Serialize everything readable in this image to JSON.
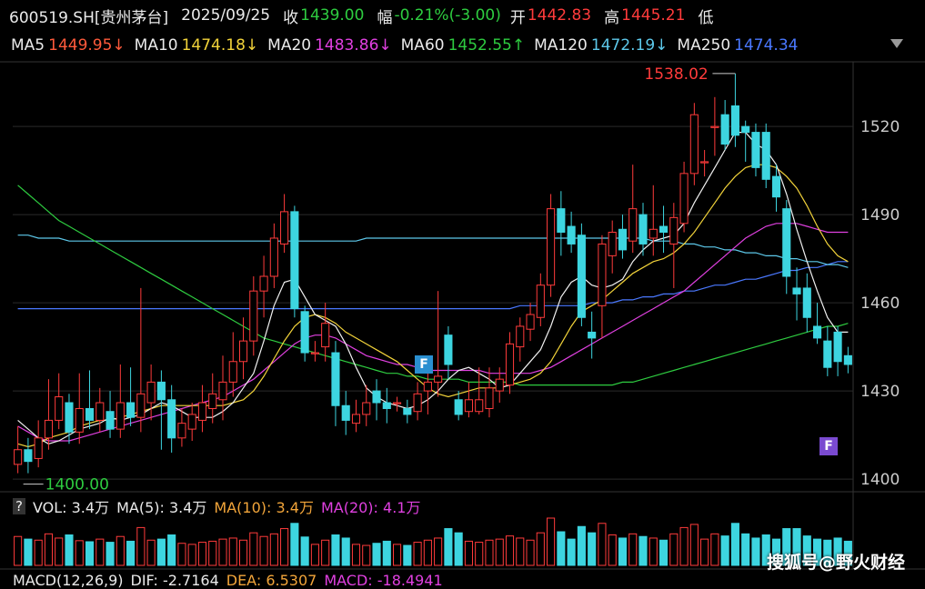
{
  "header": {
    "symbol": "600519.SH[贵州茅台]",
    "date": "2025/09/25",
    "close_label": "收",
    "close": "1439.00",
    "change_label": "幅",
    "change": "-0.21%(-3.00)",
    "open_label": "开",
    "open": "1442.83",
    "high_label": "高",
    "high": "1445.21",
    "low_label": "低"
  },
  "ma_bar": {
    "ma5_label": "MA5",
    "ma5": "1449.95↓",
    "ma10_label": "MA10",
    "ma10": "1474.18↓",
    "ma20_label": "MA20",
    "ma20": "1483.86↓",
    "ma60_label": "MA60",
    "ma60": "1452.55↑",
    "ma120_label": "MA120",
    "ma120": "1472.19↓",
    "ma250_label": "MA250",
    "ma250": "1474.34"
  },
  "volume_bar": {
    "question": "?",
    "vol": "VOL: 3.4万",
    "ma5": "MA(5): 3.4万",
    "ma10": "MA(10): 3.4万",
    "ma20": "MA(20): 4.1万"
  },
  "macd_bar": {
    "label": "MACD(12,26,9)",
    "dif": "DIF: -2.7164",
    "dea": "DEA: 6.5307",
    "macd": "MACD: -18.4941"
  },
  "annotations": {
    "high_marker": "1538.02",
    "low_marker": "1400.00",
    "flag1": "F",
    "flag2": "F"
  },
  "watermark": "搜狐号@野火财经",
  "colors": {
    "up": "#ff3b3b",
    "down": "#3dd5e0",
    "ma5": "#f0f0f0",
    "ma10": "#f2d33a",
    "ma20": "#e040e0",
    "ma60": "#2ecc40",
    "ma120": "#5dc8ea",
    "ma250": "#4a78ff",
    "grid": "#2a2a2a",
    "change": "#2ecc40",
    "price_up": "#ff3b3b"
  },
  "chart_data": {
    "type": "candlestick",
    "yaxis_ticks": [
      1400,
      1430,
      1460,
      1490,
      1520
    ],
    "ylim": [
      1396,
      1542
    ],
    "candles": [
      {
        "o": 1405,
        "c": 1410,
        "h": 1418,
        "l": 1402
      },
      {
        "o": 1410,
        "c": 1406,
        "h": 1414,
        "l": 1402
      },
      {
        "o": 1407,
        "c": 1414,
        "h": 1420,
        "l": 1404
      },
      {
        "o": 1414,
        "c": 1420,
        "h": 1434,
        "l": 1410
      },
      {
        "o": 1420,
        "c": 1428,
        "h": 1436,
        "l": 1417
      },
      {
        "o": 1426,
        "c": 1416,
        "h": 1429,
        "l": 1412
      },
      {
        "o": 1416,
        "c": 1424,
        "h": 1436,
        "l": 1412
      },
      {
        "o": 1424,
        "c": 1420,
        "h": 1437,
        "l": 1417
      },
      {
        "o": 1420,
        "c": 1426,
        "h": 1431,
        "l": 1416
      },
      {
        "o": 1423,
        "c": 1417,
        "h": 1430,
        "l": 1414
      },
      {
        "o": 1417,
        "c": 1426,
        "h": 1439,
        "l": 1414
      },
      {
        "o": 1426,
        "c": 1421,
        "h": 1438,
        "l": 1418
      },
      {
        "o": 1421,
        "c": 1429,
        "h": 1465,
        "l": 1416
      },
      {
        "o": 1426,
        "c": 1433,
        "h": 1439,
        "l": 1420
      },
      {
        "o": 1433,
        "c": 1427,
        "h": 1437,
        "l": 1410
      },
      {
        "o": 1427,
        "c": 1414,
        "h": 1432,
        "l": 1409
      },
      {
        "o": 1414,
        "c": 1419,
        "h": 1424,
        "l": 1411
      },
      {
        "o": 1417,
        "c": 1422,
        "h": 1426,
        "l": 1413
      },
      {
        "o": 1420,
        "c": 1426,
        "h": 1432,
        "l": 1416
      },
      {
        "o": 1424,
        "c": 1429,
        "h": 1436,
        "l": 1419
      },
      {
        "o": 1427,
        "c": 1433,
        "h": 1442,
        "l": 1420
      },
      {
        "o": 1433,
        "c": 1440,
        "h": 1450,
        "l": 1428
      },
      {
        "o": 1440,
        "c": 1447,
        "h": 1455,
        "l": 1434
      },
      {
        "o": 1447,
        "c": 1464,
        "h": 1469,
        "l": 1442
      },
      {
        "o": 1464,
        "c": 1469,
        "h": 1476,
        "l": 1455
      },
      {
        "o": 1469,
        "c": 1482,
        "h": 1487,
        "l": 1465
      },
      {
        "o": 1480,
        "c": 1491,
        "h": 1497,
        "l": 1477
      },
      {
        "o": 1491,
        "c": 1458,
        "h": 1493,
        "l": 1455
      },
      {
        "o": 1457,
        "c": 1443,
        "h": 1459,
        "l": 1440
      },
      {
        "o": 1443,
        "c": 1443,
        "h": 1447,
        "l": 1440
      },
      {
        "o": 1445,
        "c": 1453,
        "h": 1460,
        "l": 1440
      },
      {
        "o": 1443,
        "c": 1425,
        "h": 1447,
        "l": 1418
      },
      {
        "o": 1425,
        "c": 1420,
        "h": 1430,
        "l": 1415
      },
      {
        "o": 1419,
        "c": 1422,
        "h": 1427,
        "l": 1416
      },
      {
        "o": 1422,
        "c": 1426,
        "h": 1432,
        "l": 1418
      },
      {
        "o": 1430,
        "c": 1426,
        "h": 1434,
        "l": 1420
      },
      {
        "o": 1426,
        "c": 1424,
        "h": 1431,
        "l": 1419
      },
      {
        "o": 1426,
        "c": 1426,
        "h": 1428,
        "l": 1423
      },
      {
        "o": 1424,
        "c": 1422,
        "h": 1427,
        "l": 1419
      },
      {
        "o": 1423,
        "c": 1429,
        "h": 1433,
        "l": 1420
      },
      {
        "o": 1430,
        "c": 1433,
        "h": 1439,
        "l": 1422
      },
      {
        "o": 1433,
        "c": 1435,
        "h": 1464,
        "l": 1428
      },
      {
        "o": 1449,
        "c": 1439,
        "h": 1452,
        "l": 1434
      },
      {
        "o": 1427,
        "c": 1422,
        "h": 1430,
        "l": 1420
      },
      {
        "o": 1423,
        "c": 1427,
        "h": 1433,
        "l": 1421
      },
      {
        "o": 1423,
        "c": 1427,
        "h": 1438,
        "l": 1422
      },
      {
        "o": 1424,
        "c": 1431,
        "h": 1438,
        "l": 1421
      },
      {
        "o": 1430,
        "c": 1434,
        "h": 1438,
        "l": 1426
      },
      {
        "o": 1432,
        "c": 1446,
        "h": 1450,
        "l": 1429
      },
      {
        "o": 1445,
        "c": 1452,
        "h": 1455,
        "l": 1440
      },
      {
        "o": 1451,
        "c": 1456,
        "h": 1460,
        "l": 1447
      },
      {
        "o": 1455,
        "c": 1466,
        "h": 1470,
        "l": 1452
      },
      {
        "o": 1466,
        "c": 1492,
        "h": 1497,
        "l": 1462
      },
      {
        "o": 1492,
        "c": 1484,
        "h": 1498,
        "l": 1476
      },
      {
        "o": 1486,
        "c": 1480,
        "h": 1491,
        "l": 1477
      },
      {
        "o": 1483,
        "c": 1455,
        "h": 1487,
        "l": 1452
      },
      {
        "o": 1450,
        "c": 1448,
        "h": 1457,
        "l": 1441
      },
      {
        "o": 1459,
        "c": 1480,
        "h": 1483,
        "l": 1448
      },
      {
        "o": 1476,
        "c": 1484,
        "h": 1488,
        "l": 1470
      },
      {
        "o": 1485,
        "c": 1478,
        "h": 1490,
        "l": 1475
      },
      {
        "o": 1481,
        "c": 1492,
        "h": 1507,
        "l": 1477
      },
      {
        "o": 1490,
        "c": 1480,
        "h": 1494,
        "l": 1476
      },
      {
        "o": 1482,
        "c": 1485,
        "h": 1500,
        "l": 1476
      },
      {
        "o": 1486,
        "c": 1484,
        "h": 1493,
        "l": 1477
      },
      {
        "o": 1480,
        "c": 1489,
        "h": 1494,
        "l": 1465
      },
      {
        "o": 1487,
        "c": 1504,
        "h": 1508,
        "l": 1484
      },
      {
        "o": 1504,
        "c": 1524,
        "h": 1528,
        "l": 1500
      },
      {
        "o": 1508,
        "c": 1508,
        "h": 1512,
        "l": 1503
      },
      {
        "o": 1520,
        "c": 1520,
        "h": 1530,
        "l": 1510
      },
      {
        "o": 1524,
        "c": 1514,
        "h": 1529,
        "l": 1512
      },
      {
        "o": 1527,
        "c": 1517,
        "h": 1538,
        "l": 1513
      },
      {
        "o": 1520,
        "c": 1518,
        "h": 1522,
        "l": 1508
      },
      {
        "o": 1518,
        "c": 1506,
        "h": 1521,
        "l": 1503
      },
      {
        "o": 1518,
        "c": 1502,
        "h": 1521,
        "l": 1499
      },
      {
        "o": 1503,
        "c": 1496,
        "h": 1507,
        "l": 1491
      },
      {
        "o": 1492,
        "c": 1469,
        "h": 1495,
        "l": 1463
      },
      {
        "o": 1465,
        "c": 1463,
        "h": 1472,
        "l": 1454
      },
      {
        "o": 1465,
        "c": 1455,
        "h": 1470,
        "l": 1450
      },
      {
        "o": 1452,
        "c": 1448,
        "h": 1460,
        "l": 1446
      },
      {
        "o": 1447,
        "c": 1438,
        "h": 1452,
        "l": 1435
      },
      {
        "o": 1450,
        "c": 1440,
        "h": 1452,
        "l": 1435
      },
      {
        "o": 1442,
        "c": 1439,
        "h": 1445,
        "l": 1436
      }
    ],
    "ma5": [
      1420,
      1417,
      1414,
      1412,
      1413,
      1415,
      1417,
      1418,
      1419,
      1421,
      1420,
      1421,
      1422,
      1424,
      1426,
      1425,
      1423,
      1421,
      1421,
      1421,
      1423,
      1426,
      1431,
      1436,
      1447,
      1459,
      1467,
      1468,
      1462,
      1456,
      1454,
      1452,
      1446,
      1438,
      1431,
      1428,
      1426,
      1425,
      1424,
      1425,
      1427,
      1430,
      1434,
      1437,
      1438,
      1436,
      1434,
      1431,
      1432,
      1436,
      1440,
      1444,
      1452,
      1462,
      1467,
      1469,
      1466,
      1465,
      1466,
      1468,
      1474,
      1478,
      1481,
      1482,
      1483,
      1487,
      1494,
      1500,
      1506,
      1512,
      1518,
      1518,
      1514,
      1512,
      1507,
      1497,
      1485,
      1474,
      1464,
      1455,
      1450,
      1450
    ],
    "ma10": [
      1412,
      1411,
      1412,
      1414,
      1415,
      1416,
      1418,
      1419,
      1420,
      1420,
      1421,
      1422,
      1423,
      1424,
      1425,
      1425,
      1425,
      1425,
      1425,
      1425,
      1425,
      1426,
      1427,
      1430,
      1435,
      1441,
      1447,
      1452,
      1455,
      1456,
      1455,
      1453,
      1450,
      1448,
      1446,
      1444,
      1442,
      1440,
      1437,
      1434,
      1431,
      1429,
      1428,
      1429,
      1430,
      1431,
      1431,
      1431,
      1432,
      1433,
      1434,
      1436,
      1440,
      1446,
      1452,
      1457,
      1459,
      1461,
      1464,
      1467,
      1470,
      1472,
      1474,
      1475,
      1477,
      1480,
      1484,
      1489,
      1494,
      1499,
      1503,
      1506,
      1507,
      1507,
      1506,
      1503,
      1499,
      1493,
      1486,
      1480,
      1476,
      1474
    ],
    "ma20": [
      1418,
      1416,
      1414,
      1413,
      1413,
      1413,
      1414,
      1415,
      1416,
      1417,
      1418,
      1419,
      1420,
      1421,
      1422,
      1423,
      1424,
      1425,
      1426,
      1427,
      1428,
      1430,
      1432,
      1434,
      1437,
      1440,
      1443,
      1446,
      1448,
      1449,
      1449,
      1448,
      1446,
      1444,
      1442,
      1441,
      1440,
      1439,
      1439,
      1438,
      1437,
      1437,
      1437,
      1437,
      1437,
      1437,
      1436,
      1436,
      1436,
      1436,
      1436,
      1437,
      1438,
      1440,
      1442,
      1444,
      1446,
      1448,
      1450,
      1452,
      1454,
      1456,
      1458,
      1460,
      1462,
      1464,
      1467,
      1470,
      1473,
      1476,
      1479,
      1482,
      1484,
      1486,
      1487,
      1487,
      1487,
      1486,
      1485,
      1484,
      1484,
      1484
    ],
    "ma60": [
      1500,
      1497,
      1494,
      1491,
      1488,
      1486,
      1484,
      1482,
      1480,
      1478,
      1476,
      1474,
      1472,
      1470,
      1468,
      1466,
      1464,
      1462,
      1460,
      1458,
      1456,
      1454,
      1452,
      1450,
      1448,
      1447,
      1446,
      1445,
      1444,
      1443,
      1442,
      1441,
      1440,
      1439,
      1438,
      1437,
      1436,
      1436,
      1435,
      1435,
      1434,
      1434,
      1434,
      1434,
      1433,
      1433,
      1433,
      1433,
      1433,
      1432,
      1432,
      1432,
      1432,
      1432,
      1432,
      1432,
      1432,
      1432,
      1432,
      1433,
      1433,
      1434,
      1435,
      1436,
      1437,
      1438,
      1439,
      1440,
      1441,
      1442,
      1443,
      1444,
      1445,
      1446,
      1447,
      1448,
      1449,
      1450,
      1451,
      1452,
      1452,
      1453
    ],
    "ma120": [
      1483,
      1483,
      1482,
      1482,
      1482,
      1481,
      1481,
      1481,
      1481,
      1481,
      1481,
      1481,
      1481,
      1481,
      1481,
      1481,
      1481,
      1481,
      1481,
      1481,
      1481,
      1481,
      1481,
      1481,
      1481,
      1481,
      1481,
      1481,
      1481,
      1481,
      1481,
      1481,
      1481,
      1481,
      1482,
      1482,
      1482,
      1482,
      1482,
      1482,
      1482,
      1482,
      1482,
      1482,
      1482,
      1482,
      1482,
      1482,
      1482,
      1482,
      1482,
      1482,
      1482,
      1482,
      1482,
      1482,
      1482,
      1482,
      1482,
      1482,
      1482,
      1482,
      1481,
      1481,
      1481,
      1480,
      1480,
      1479,
      1479,
      1478,
      1478,
      1477,
      1477,
      1476,
      1476,
      1475,
      1475,
      1474,
      1474,
      1473,
      1473,
      1472
    ],
    "ma250": [
      1458,
      1458,
      1458,
      1458,
      1458,
      1458,
      1458,
      1458,
      1458,
      1458,
      1458,
      1458,
      1458,
      1458,
      1458,
      1458,
      1458,
      1458,
      1458,
      1458,
      1458,
      1458,
      1458,
      1458,
      1458,
      1458,
      1458,
      1458,
      1458,
      1458,
      1458,
      1458,
      1458,
      1458,
      1458,
      1458,
      1458,
      1458,
      1458,
      1458,
      1458,
      1458,
      1458,
      1458,
      1458,
      1458,
      1458,
      1458,
      1458,
      1459,
      1459,
      1459,
      1459,
      1459,
      1459,
      1459,
      1460,
      1460,
      1460,
      1461,
      1461,
      1462,
      1462,
      1463,
      1463,
      1464,
      1464,
      1465,
      1466,
      1466,
      1467,
      1468,
      1468,
      1469,
      1470,
      1471,
      1471,
      1472,
      1472,
      1473,
      1474,
      1474
    ],
    "volumes": [
      55,
      50,
      48,
      60,
      52,
      58,
      47,
      45,
      50,
      44,
      55,
      46,
      72,
      48,
      50,
      58,
      42,
      40,
      44,
      46,
      50,
      52,
      48,
      62,
      55,
      60,
      70,
      80,
      54,
      40,
      48,
      58,
      52,
      40,
      38,
      42,
      46,
      40,
      38,
      44,
      48,
      52,
      70,
      62,
      46,
      44,
      48,
      50,
      56,
      52,
      48,
      62,
      90,
      64,
      50,
      74,
      62,
      80,
      58,
      52,
      60,
      55,
      52,
      48,
      60,
      72,
      78,
      50,
      60,
      56,
      80,
      60,
      52,
      58,
      50,
      70,
      70,
      56,
      50,
      48,
      52,
      46
    ]
  }
}
